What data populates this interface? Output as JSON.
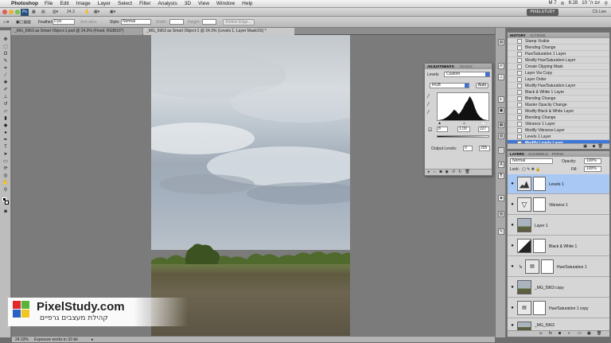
{
  "menubar": {
    "app": "Photoshop",
    "items": [
      "File",
      "Edit",
      "Image",
      "Layer",
      "Select",
      "Filter",
      "Analysis",
      "3D",
      "View",
      "Window",
      "Help"
    ],
    "status": {
      "time": "6:28",
      "day": "יום ה׳ 10",
      "flag": "M 7"
    }
  },
  "appbar": {
    "zoom": "24.3",
    "workspace": "PIXELSTUDY",
    "cs_live": "CS Live"
  },
  "options": {
    "feather_label": "Feather:",
    "feather_value": "0 px",
    "antialias_label": "Anti-alias",
    "style_label": "Style:",
    "style_value": "Normal",
    "width_label": "Width:",
    "height_label": "Height:",
    "refine_label": "Refine Edge..."
  },
  "tabs": [
    {
      "label": "_MG_5963 as Smart Object-1.psd @ 24.3% (Fixed, RGB/16*)"
    },
    {
      "label": "_MG_5963 as Smart Object-1 @ 24.3% (Levels 1, Layer Mask/16) *"
    }
  ],
  "status_bar": {
    "zoom": "24.33%",
    "message": "Exposure works in 32-bit"
  },
  "adjustments": {
    "tabs": [
      "ADJUSTMENTS",
      "MASKS"
    ],
    "title": "Levels",
    "preset": "Custom",
    "channel": "RGB",
    "auto": "Auto",
    "input_black": "8",
    "input_gamma": "1.00",
    "input_white": "227",
    "output_label": "Output Levels:",
    "output_black": "0",
    "output_white": "255"
  },
  "history": {
    "tabs": [
      "HISTORY",
      "ACTIONS"
    ],
    "items": [
      "Stamp Visible",
      "Blending Change",
      "Hue/Saturation 1 Layer",
      "Modify Hue/Saturation Layer",
      "Create Clipping Mask",
      "Layer Via Copy",
      "Layer Order",
      "Modify Hue/Saturation Layer",
      "Black & White 1 Layer",
      "Blending Change",
      "Master Opacity Change",
      "Modify Black & White Layer",
      "Blending Change",
      "Vibrance 1 Layer",
      "Modify Vibrance Layer",
      "Levels 1 Layer",
      "Modify Levels Layer"
    ]
  },
  "layers_panel": {
    "tabs": [
      "LAYERS",
      "CHANNELS",
      "PATHS"
    ],
    "blend_mode": "Normal",
    "opacity_label": "Opacity:",
    "opacity": "100%",
    "lock_label": "Lock:",
    "fill_label": "Fill:",
    "fill": "100%",
    "layers": [
      {
        "name": "Levels 1"
      },
      {
        "name": "Vibrance 1"
      },
      {
        "name": "Layer 1"
      },
      {
        "name": "Black & White 1"
      },
      {
        "name": "Hue/Saturation 1"
      },
      {
        "name": "_MG_5963 copy"
      },
      {
        "name": "Hue/Saturation 1 copy"
      },
      {
        "name": "_MG_5963"
      }
    ]
  },
  "logo": {
    "brand": "PixelStudy.com",
    "tagline": "קהילת מעצבים גרפיים"
  },
  "colors": {
    "selection_blue": "#3c77d9",
    "selected_layer": "#a9c8f3",
    "logo_red": "#e3262b",
    "logo_green": "#5bb33a",
    "logo_blue": "#2c62c4",
    "logo_yellow": "#f2c521"
  }
}
